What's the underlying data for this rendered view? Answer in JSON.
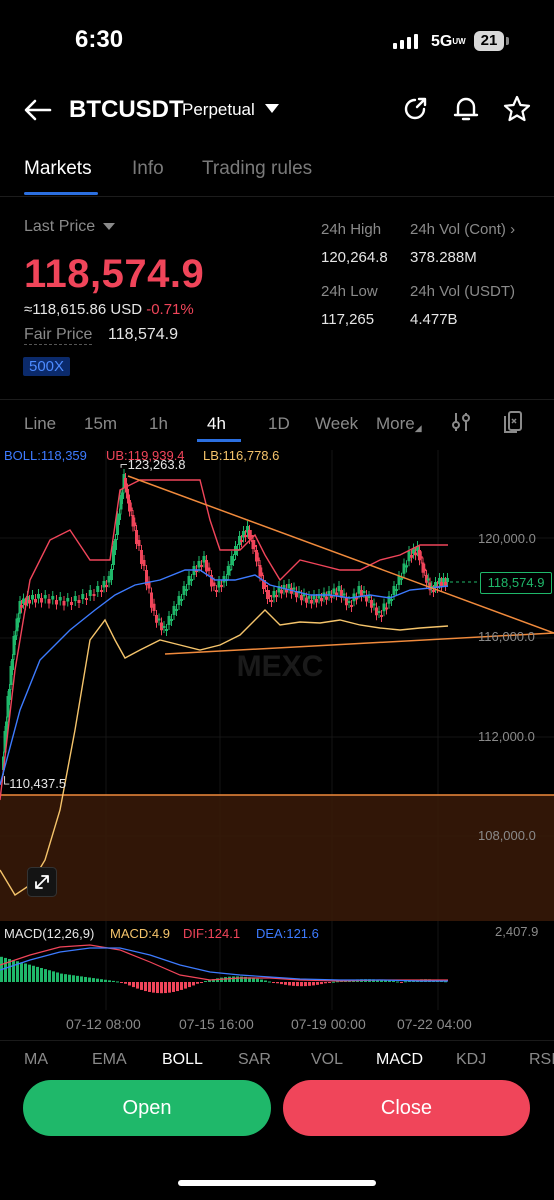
{
  "status_bar": {
    "time": "6:30",
    "network": "5G",
    "network_sub": "UW",
    "battery": "21"
  },
  "header": {
    "symbol": "BTCUSDT",
    "contract_type": "Perpetual"
  },
  "tabs": [
    {
      "label": "Markets"
    },
    {
      "label": "Info"
    },
    {
      "label": "Trading rules"
    }
  ],
  "price": {
    "last_price_label": "Last Price",
    "last_price": "118,574.9",
    "usd_equiv": "≈118,615.86 USD",
    "change": "-0.71%",
    "fair_price_label": "Fair Price",
    "fair_price": "118,574.9",
    "leverage": "500X"
  },
  "stats": {
    "high_label": "24h High",
    "high": "120,264.8",
    "vol_cont_label": "24h Vol (Cont)",
    "vol_cont": "378.288M",
    "low_label": "24h Low",
    "low": "117,265",
    "vol_usdt_label": "24h Vol  (USDT)",
    "vol_usdt": "4.477B"
  },
  "intervals": [
    {
      "label": "Line"
    },
    {
      "label": "15m"
    },
    {
      "label": "1h"
    },
    {
      "label": "4h"
    },
    {
      "label": "1D"
    },
    {
      "label": "Week"
    },
    {
      "label": "More"
    }
  ],
  "boll": {
    "mid": "BOLL:118,359",
    "ub": "UB:119,939.4",
    "lb": "LB:116,778.6"
  },
  "chart": {
    "y_labels": [
      "120,000.0",
      "116,000.0",
      "112,000.0",
      "108,000.0"
    ],
    "current_price_tag": "118,574.9",
    "high_marker": "123,263.8",
    "low_marker": "110,437.5",
    "macd_top_value": "2,407.9",
    "x_labels": [
      "07-12 08:00",
      "07-15 16:00",
      "07-19 00:00",
      "07-22 04:00"
    ],
    "watermark": "MEXC",
    "colors": {
      "up": "#1fb86a",
      "down": "#f0455a",
      "boll_mid": "#3d7bff",
      "ub": "#f0455a",
      "lb": "#f5c46b",
      "trend": "#f08a3c"
    }
  },
  "macd": {
    "label": "MACD(12,26,9)",
    "macd": "MACD:4.9",
    "dif": "DIF:124.1",
    "dea": "DEA:121.6"
  },
  "indicators": [
    {
      "label": "MA"
    },
    {
      "label": "EMA"
    },
    {
      "label": "BOLL"
    },
    {
      "label": "SAR"
    },
    {
      "label": "VOL"
    },
    {
      "label": "MACD"
    },
    {
      "label": "KDJ"
    },
    {
      "label": "RSI"
    }
  ],
  "actions": {
    "open": "Open",
    "close": "Close"
  }
}
